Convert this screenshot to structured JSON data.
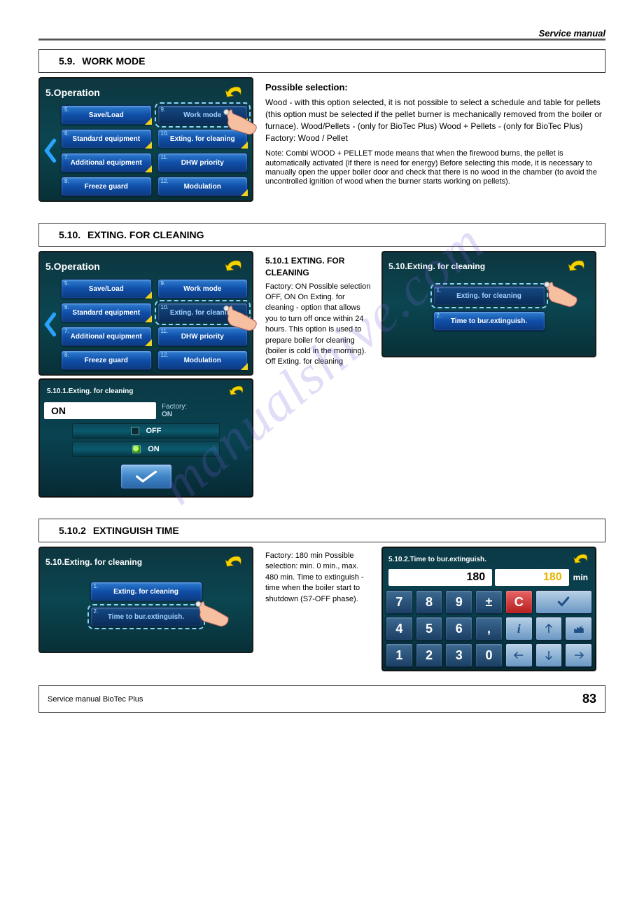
{
  "doc_header": "Service manual",
  "footer": {
    "left": "Service manual BioTec Plus",
    "page": "83"
  },
  "watermark": "manualshive.com",
  "sections": {
    "s59": {
      "num": "5.9.",
      "title": "WORK MODE",
      "heading": "5.Operation"
    },
    "s510": {
      "num": "5.10.",
      "title": "EXTING. FOR CLEANING",
      "heading": "5.Operation",
      "subheading": "5.10.Exting. for cleaning"
    },
    "s5102": {
      "num": "5.10.2",
      "title": "EXTINGUISH TIME",
      "subheading": "5.10.Exting. for cleaning"
    }
  },
  "menu": {
    "items": [
      {
        "num": "5.",
        "label": "Save/Load"
      },
      {
        "num": "6.",
        "label": "Standard equipment"
      },
      {
        "num": "7.",
        "label": "Additional equipment"
      },
      {
        "num": "8.",
        "label": "Freeze guard"
      },
      {
        "num": "9.",
        "label": "Work mode"
      },
      {
        "num": "10.",
        "label": "Exting. for cleaning"
      },
      {
        "num": "11.",
        "label": "DHW priority"
      },
      {
        "num": "12.",
        "label": "Modulation"
      }
    ]
  },
  "desc59": {
    "h": "Possible selection:",
    "body": "Wood  -  with this option selected, it is not possible to select a schedule and table for pellets (this option must be selected if the pellet burner is mechanically removed from the boiler or furnace). Wood/Pellets  -  (only for BioTec Plus) Wood + Pellets  -  (only for BioTec Plus) Factory: Wood / Pellet",
    "note": "Note: Combi WOOD + PELLET mode means that when the firewood burns, the pellet is automatically activated (if there is need for energy) Before selecting this mode, it is necessary to manually open the upper boiler door and check that there is no wood in the chamber (to avoid the uncontrolled ignition of wood when the burner starts working on pellets)."
  },
  "desc510": {
    "h": "5.10.1  EXTING. FOR CLEANING",
    "body": "Factory: ON   Possible selection OFF, ON   On Exting. for cleaning - option that allows you to turn off once within 24 hours. This option is used to prepare boiler for cleaning (boiler is cold in the morning).   Off Exting. for cleaning"
  },
  "s5101": {
    "hdr": "5.10.1.Exting. for cleaning",
    "val": "ON",
    "opt_off": "OFF",
    "opt_on": "ON",
    "factory_label": "Factory:",
    "factory_val": "ON"
  },
  "exting_sub": {
    "heading": "5.10.Exting. for cleaning",
    "btn1": {
      "num": "1.",
      "label": "Exting. for cleaning"
    },
    "btn2": {
      "num": "2.",
      "label": "Time to bur.extinguish."
    }
  },
  "keypad": {
    "hdr": "5.10.2.Time to bur.extinguish.",
    "val": "180",
    "val2": "180",
    "unit": "min",
    "desc": "Factory: 180 min   Possible selection: min. 0 min., max. 480 min.   Time to extinguish - time when the boiler start to shutdown (S7-OFF phase).",
    "keys": [
      "7",
      "8",
      "9",
      "±",
      "C",
      "ok",
      "4",
      "5",
      "6",
      ",",
      "i",
      "up",
      "factory",
      "1",
      "2",
      "3",
      "0",
      "left",
      "down",
      "right"
    ]
  }
}
